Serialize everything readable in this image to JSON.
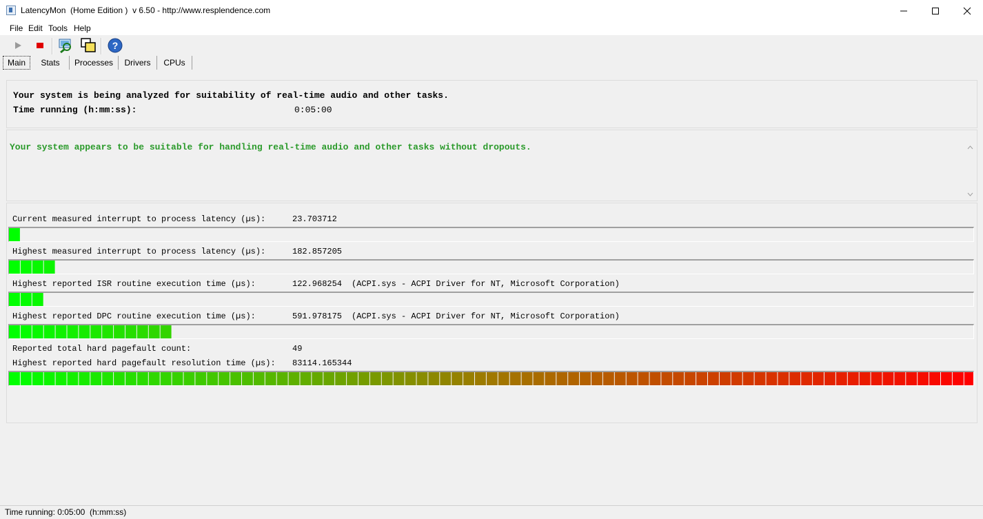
{
  "window": {
    "title": "LatencyMon  (Home Edition )  v 6.50 - http://www.resplendence.com"
  },
  "menu": [
    "File",
    "Edit",
    "Tools",
    "Help"
  ],
  "toolbar_icons": [
    "play-icon",
    "stop-icon",
    "driver-search-icon",
    "windows-icon",
    "help-icon"
  ],
  "tabs": [
    "Main",
    "Stats",
    "Processes",
    "Drivers",
    "CPUs"
  ],
  "analysis": {
    "line1": "Your system is being analyzed for suitability of real-time audio and other tasks.",
    "time_label": "Time running (h:mm:ss):",
    "time_value": "0:05:00"
  },
  "verdict": {
    "text": "Your system appears to be suitable for handling real-time audio and other tasks without dropouts.",
    "color": "#2a9a2a"
  },
  "stats": [
    {
      "label": "Current measured interrupt to process latency (µs):",
      "value": "23.703712",
      "extra": "",
      "segments": 1
    },
    {
      "label": "Highest measured interrupt to process latency (µs):",
      "value": "182.857205",
      "extra": "",
      "segments": 4
    },
    {
      "label": "Highest reported ISR routine execution time (µs):",
      "value": "122.968254",
      "extra": "(ACPI.sys - ACPI Driver for NT, Microsoft Corporation)",
      "segments": 3
    },
    {
      "label": "Highest reported DPC routine execution time (µs):",
      "value": "591.978175",
      "extra": "(ACPI.sys - ACPI Driver for NT, Microsoft Corporation)",
      "segments": 14
    },
    {
      "label": "Reported total hard pagefault count:",
      "value": "49",
      "extra": ""
    },
    {
      "label": "Highest reported hard pagefault resolution time (µs):",
      "value": "83114.165344",
      "extra": "",
      "segments": 83
    }
  ],
  "status": {
    "text": "Time running: 0:05:00  (h:mm:ss)"
  }
}
